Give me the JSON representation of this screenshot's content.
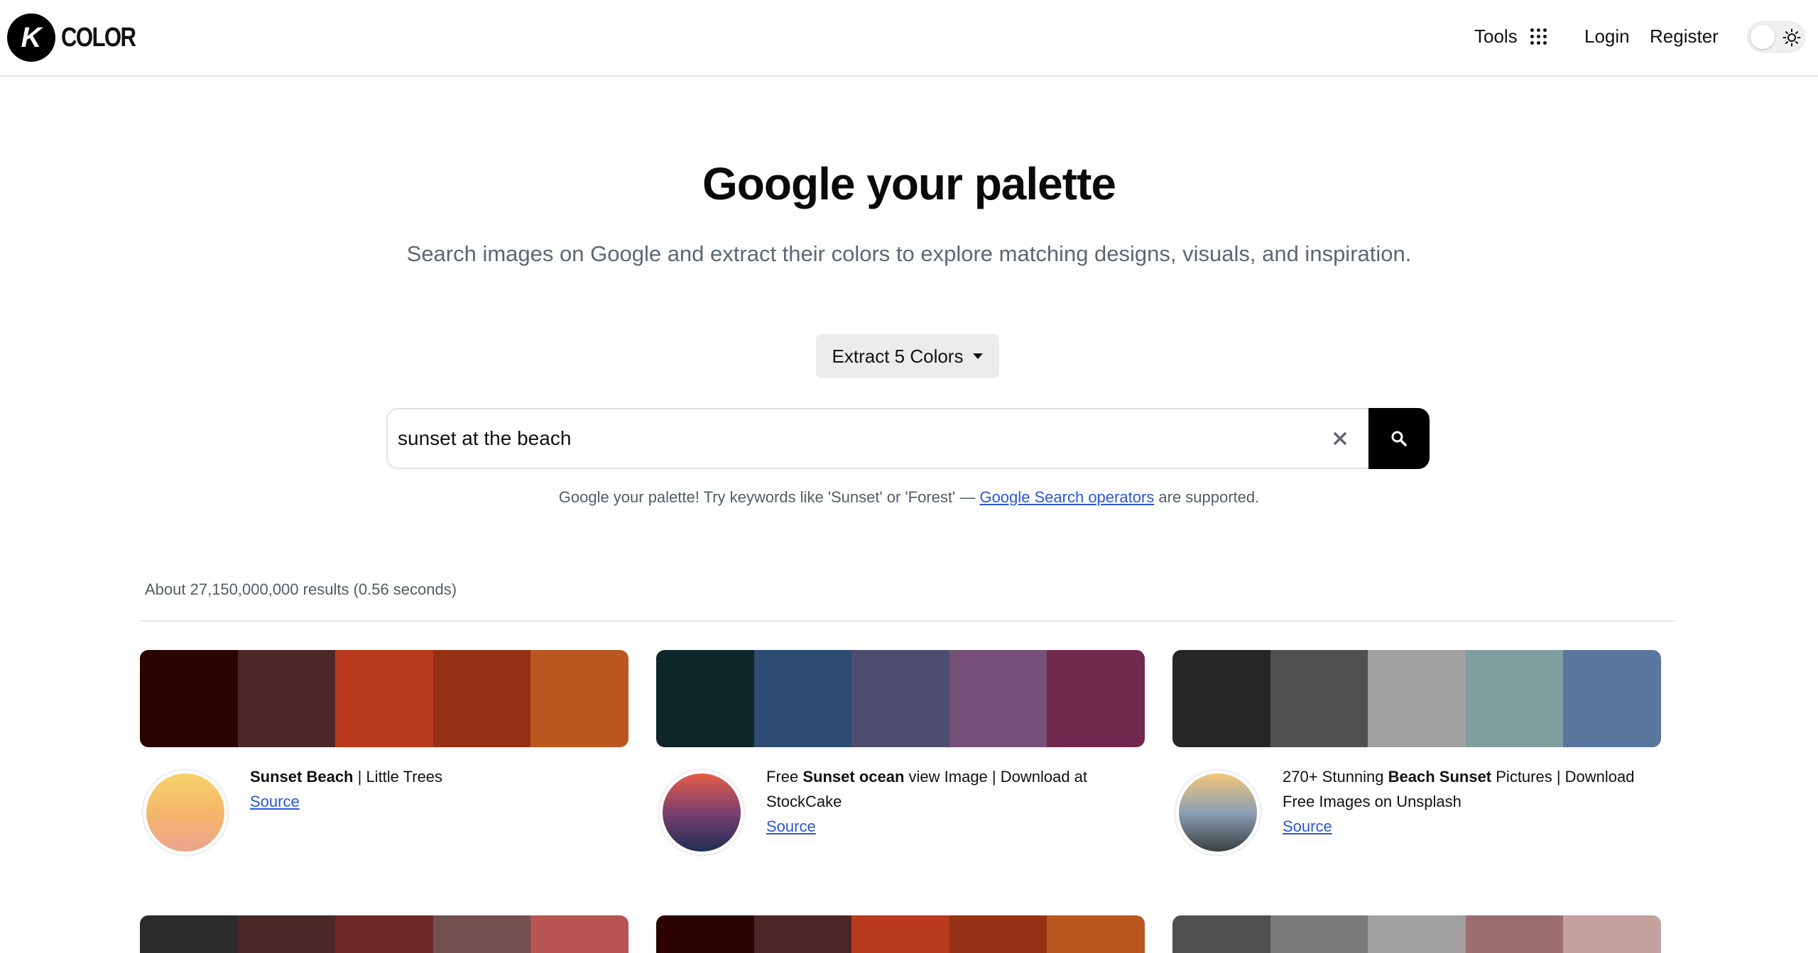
{
  "header": {
    "logo_letter": "K",
    "logo_text": "COLOR",
    "tools_label": "Tools",
    "login_label": "Login",
    "register_label": "Register"
  },
  "hero": {
    "title": "Google your palette",
    "subtitle": "Search images on Google and extract their colors to explore matching designs, visuals, and inspiration.",
    "extract_label": "Extract 5 Colors"
  },
  "search": {
    "value": "sunset at the beach"
  },
  "hint": {
    "prefix": "Google your palette! Try keywords like 'Sunset' or 'Forest' — ",
    "link": "Google Search operators",
    "suffix": " are supported."
  },
  "results": {
    "count_text": "About 27,150,000,000 results (0.56 seconds)",
    "source_label": "Source",
    "cards": [
      {
        "title_parts": [
          {
            "b": "Sunset Beach"
          },
          {
            "t": " | Little Trees"
          }
        ],
        "colors": [
          "#2b0303",
          "#4d2727",
          "#b93a1d",
          "#953216",
          "#ba5721"
        ],
        "thumb": [
          "#f6d36b",
          "#f4b76a",
          "#e9a48d"
        ]
      },
      {
        "title_parts": [
          {
            "t": "Free "
          },
          {
            "b": "Sunset ocean"
          },
          {
            "t": " view Image | Download at StockCake"
          }
        ],
        "colors": [
          "#0f2628",
          "#2e4c73",
          "#4d4d70",
          "#765078",
          "#72294e"
        ],
        "thumb": [
          "#e55d4a",
          "#7b3f6e",
          "#1f2f55"
        ]
      },
      {
        "title_parts": [
          {
            "t": "270+ Stunning "
          },
          {
            "b": "Beach Sunset"
          },
          {
            "t": " Pictures | Download Free Images on Unsplash"
          }
        ],
        "colors": [
          "#262626",
          "#505050",
          "#a1a1a1",
          "#809e9e",
          "#5a769d"
        ],
        "thumb": [
          "#f2c77a",
          "#8ca0b5",
          "#3b3f3f"
        ]
      }
    ],
    "partial_palettes": [
      [
        "#2b2b2b",
        "#4b2828",
        "#6e2828",
        "#734e4e",
        "#b75454"
      ],
      [
        "#2b0303",
        "#4d2727",
        "#b93a1d",
        "#953216",
        "#ba5721"
      ],
      [
        "#505050",
        "#7a7a7a",
        "#a1a1a1",
        "#9c6e6e",
        "#c4a09e"
      ]
    ]
  }
}
